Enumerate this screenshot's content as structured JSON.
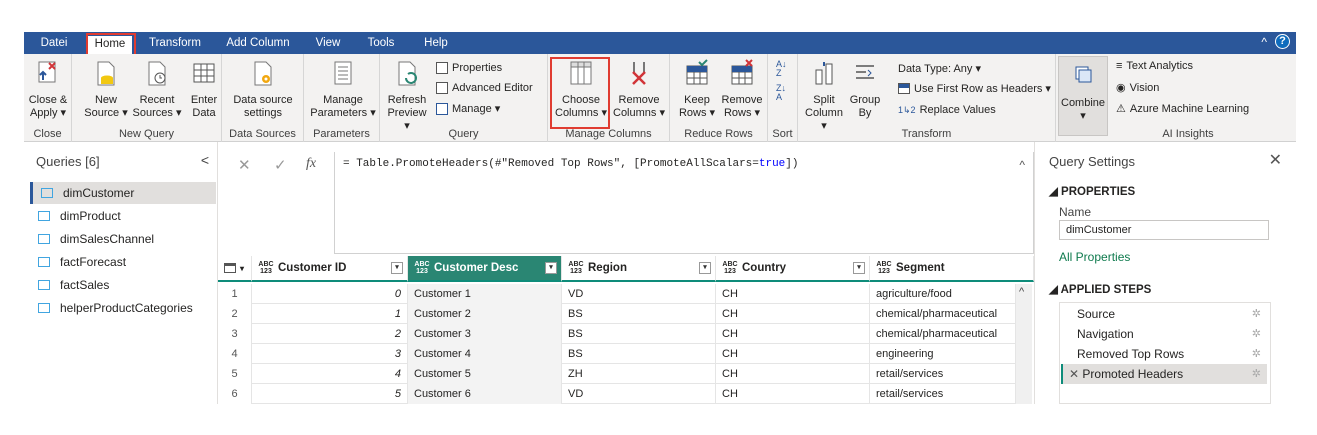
{
  "tabs": [
    "Datei",
    "Home",
    "Transform",
    "Add Column",
    "View",
    "Tools",
    "Help"
  ],
  "help": {
    "caret": "^",
    "q": "?"
  },
  "ribbon": {
    "close": {
      "btn1": "Close &",
      "btn1b": "Apply ▾",
      "group": "Close"
    },
    "newquery": {
      "new": "New",
      "new2": "Source ▾",
      "recent": "Recent",
      "recent2": "Sources ▾",
      "enter": "Enter",
      "enter2": "Data",
      "group": "New Query"
    },
    "datasources": {
      "btn": "Data source",
      "btn2": "settings",
      "group": "Data Sources"
    },
    "parameters": {
      "btn": "Manage",
      "btn2": "Parameters ▾",
      "group": "Parameters"
    },
    "query": {
      "refresh": "Refresh",
      "refresh2": "Preview ▾",
      "properties": "Properties",
      "advanced": "Advanced Editor",
      "manage": "Manage ▾",
      "group": "Query"
    },
    "managecols": {
      "choose": "Choose",
      "choose2": "Columns ▾",
      "remove": "Remove",
      "remove2": "Columns ▾",
      "group": "Manage Columns"
    },
    "reducerows": {
      "keep": "Keep",
      "keep2": "Rows ▾",
      "remove": "Remove",
      "remove2": "Rows ▾",
      "group": "Reduce Rows"
    },
    "sort": {
      "group": "Sort"
    },
    "transform": {
      "split": "Split",
      "split2": "Column ▾",
      "groupby": "Group",
      "groupby2": "By",
      "datatype": "Data Type: Any ▾",
      "firstrow": "Use First Row as Headers ▾",
      "replace": "Replace Values",
      "group": "Transform"
    },
    "combine": {
      "btn": "Combine",
      "btn2": "▾"
    },
    "ai": {
      "text": "Text Analytics",
      "vision": "Vision",
      "aml": "Azure Machine Learning",
      "group": "AI Insights"
    }
  },
  "queries": {
    "header": "Queries [6]",
    "chevron": "<",
    "items": [
      "dimCustomer",
      "dimProduct",
      "dimSalesChannel",
      "factForecast",
      "factSales",
      "helperProductCategories"
    ]
  },
  "formula": {
    "cancel": "✕",
    "ok": "✓",
    "fx": "fx",
    "expr_pre": "= Table.PromoteHeaders(#\"Removed Top Rows\", [PromoteAllScalars=",
    "expr_kw": "true",
    "expr_post": "])",
    "collapse": "^"
  },
  "table": {
    "type_label": "ABC\n123",
    "columns": [
      "Customer ID",
      "Customer Desc",
      "Region",
      "Country",
      "Segment"
    ],
    "rows": [
      [
        "1",
        "0",
        "Customer 1",
        "VD",
        "CH",
        "agriculture/food"
      ],
      [
        "2",
        "1",
        "Customer 2",
        "BS",
        "CH",
        "chemical/pharmaceutical"
      ],
      [
        "3",
        "2",
        "Customer 3",
        "BS",
        "CH",
        "chemical/pharmaceutical"
      ],
      [
        "4",
        "3",
        "Customer 4",
        "BS",
        "CH",
        "engineering"
      ],
      [
        "5",
        "4",
        "Customer 5",
        "ZH",
        "CH",
        "retail/services"
      ],
      [
        "6",
        "5",
        "Customer 6",
        "VD",
        "CH",
        "retail/services"
      ]
    ]
  },
  "settings": {
    "title": "Query Settings",
    "close": "✕",
    "properties": "◢ PROPERTIES",
    "name_label": "Name",
    "name_value": "dimCustomer",
    "all_props": "All Properties",
    "steps_title": "◢ APPLIED STEPS",
    "steps": [
      "Source",
      "Navigation",
      "Removed Top Rows",
      "Promoted Headers"
    ]
  },
  "colors": {
    "accent": "#2b579a",
    "teal": "#2a8673",
    "red": "#e03c31",
    "link": "#0e7a4d"
  }
}
